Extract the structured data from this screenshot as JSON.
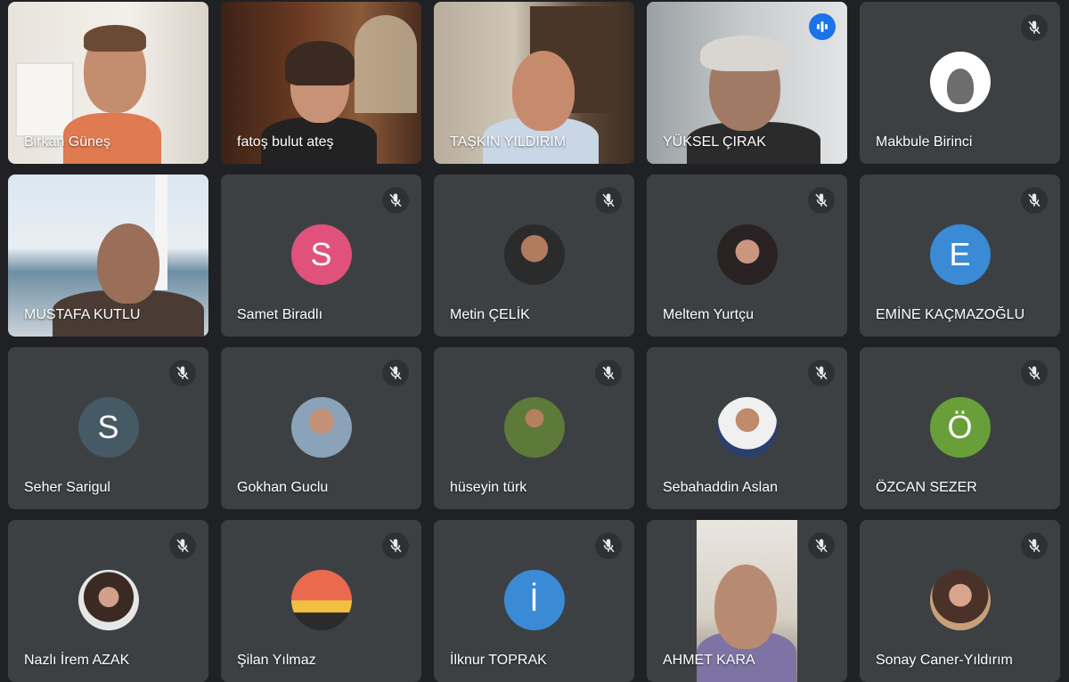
{
  "participants": [
    {
      "name": "Birkan Güneş"
    },
    {
      "name": "fatoş bulut ateş"
    },
    {
      "name": "TAŞKIN YILDIRIM"
    },
    {
      "name": "YÜKSEL ÇIRAK"
    },
    {
      "name": "Makbule Birinci"
    },
    {
      "name": "MUSTAFA KUTLU"
    },
    {
      "name": "Samet Biradlı",
      "initial": "S",
      "color": "#e0527c"
    },
    {
      "name": "Metin ÇELİK"
    },
    {
      "name": "Meltem Yurtçu"
    },
    {
      "name": "EMİNE KAÇMAZOĞLU",
      "initial": "E",
      "color": "#3a8ad6"
    },
    {
      "name": "Seher Sarigul",
      "initial": "S",
      "color": "#455a64"
    },
    {
      "name": "Gokhan Guclu"
    },
    {
      "name": "hüseyin türk"
    },
    {
      "name": "Sebahaddin Aslan"
    },
    {
      "name": "ÖZCAN SEZER",
      "initial": "Ö",
      "color": "#689f38"
    },
    {
      "name": "Nazlı İrem AZAK"
    },
    {
      "name": "Şilan Yılmaz"
    },
    {
      "name": "İlknur TOPRAK",
      "initial": "İ",
      "color": "#3a8ad6"
    },
    {
      "name": "AHMET KARA"
    },
    {
      "name": "Sonay Caner-Yıldırım"
    }
  ],
  "colors": {
    "background": "#202124",
    "tile": "#3c4043",
    "active_border": "#8ab4f8",
    "speaking": "#1a73e8"
  }
}
